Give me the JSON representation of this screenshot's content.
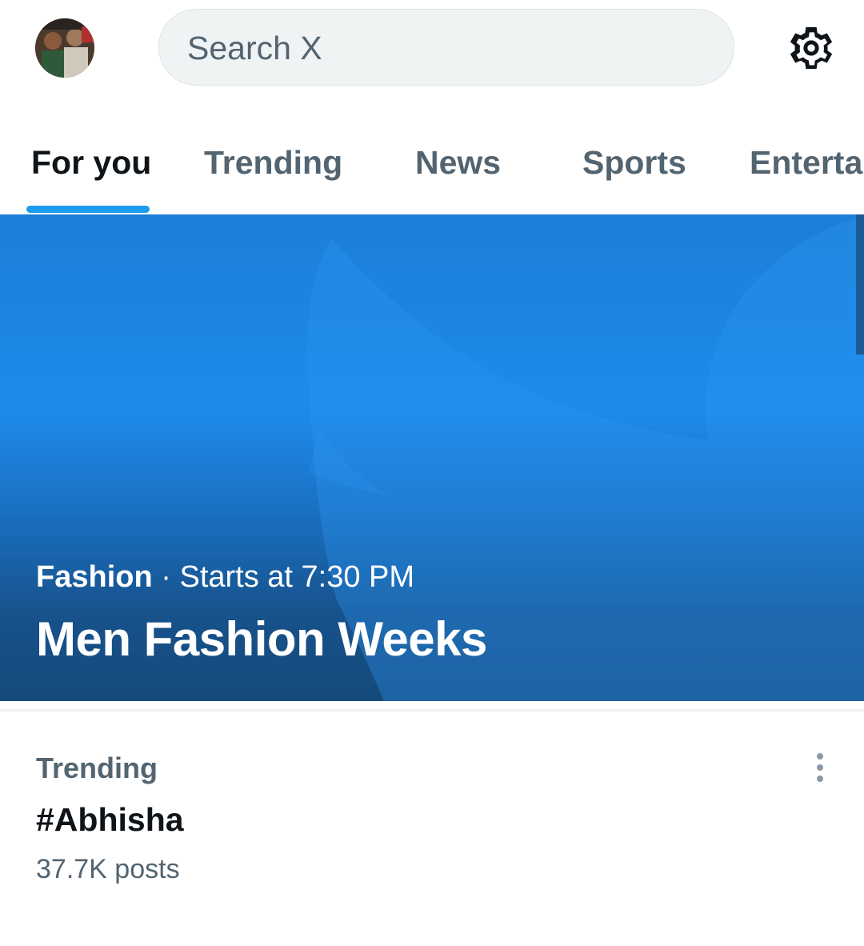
{
  "header": {
    "search_placeholder": "Search X",
    "avatar_icon": "user-avatar",
    "settings_icon": "gear-icon"
  },
  "tabs": [
    {
      "label": "For you",
      "active": true
    },
    {
      "label": "Trending",
      "active": false
    },
    {
      "label": "News",
      "active": false
    },
    {
      "label": "Sports",
      "active": false
    },
    {
      "label": "Enterta",
      "active": false
    }
  ],
  "hero": {
    "category": "Fashion",
    "separator": "·",
    "time": "Starts at 7:30 PM",
    "title": "Men Fashion Weeks"
  },
  "trend": {
    "context": "Trending",
    "name": "#Abhisha",
    "count": "37.7K posts",
    "more_icon": "more-vertical-icon"
  },
  "colors": {
    "accent": "#1d9bf0",
    "text_primary": "#0f1419",
    "text_secondary": "#536471",
    "search_bg": "#eff3f4"
  }
}
